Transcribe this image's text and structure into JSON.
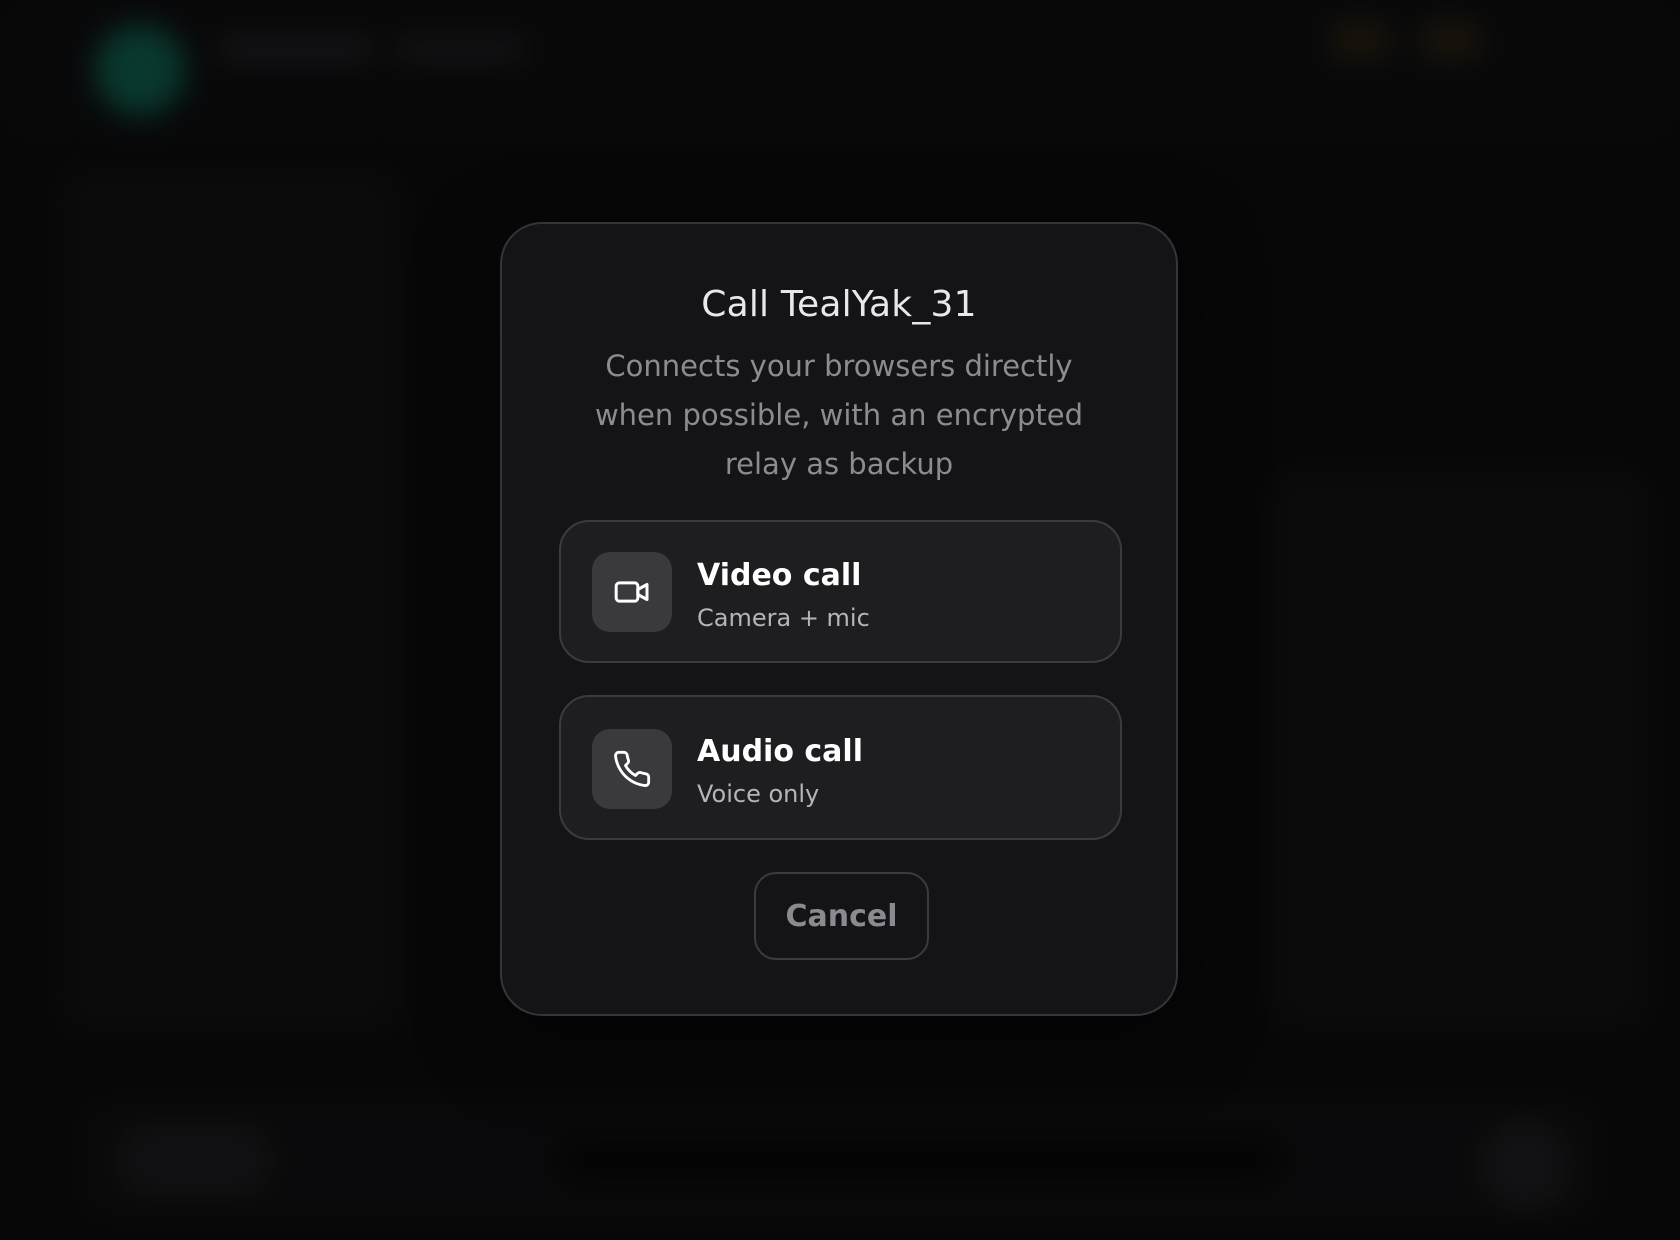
{
  "dialog": {
    "title": "Call TealYak_31",
    "subtitle": "Connects your browsers directly when possible, with an encrypted relay as backup",
    "options": [
      {
        "title": "Video call",
        "description": "Camera + mic",
        "icon": "video-camera-icon"
      },
      {
        "title": "Audio call",
        "description": "Voice only",
        "icon": "phone-icon"
      }
    ],
    "cancel_label": "Cancel"
  },
  "colors": {
    "modal_background": "#141417",
    "option_background": "#1e1e21",
    "icon_tile": "#3a3a3e",
    "border": "#3a3a40",
    "background_avatar_accent": "#0f5f4e"
  }
}
